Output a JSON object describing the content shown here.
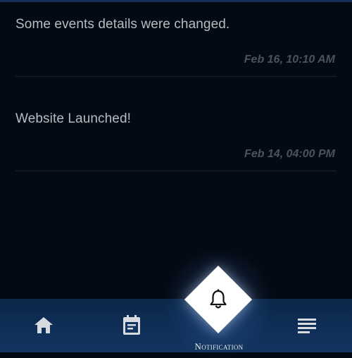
{
  "notifications": [
    {
      "message": "Some events details were changed.",
      "timestamp": "Feb 16, 10:10 AM"
    },
    {
      "message": "Website Launched!",
      "timestamp": "Feb 14, 04:00 PM"
    }
  ],
  "nav": {
    "items": [
      {
        "icon": "home-icon"
      },
      {
        "icon": "calendar-icon"
      },
      {
        "icon": "bell-icon",
        "label": "Notification",
        "active": true
      },
      {
        "icon": "menu-icon"
      }
    ]
  },
  "colors": {
    "background": "#040a14",
    "nav_bar": "#102f58",
    "message_text": "#b8bcc2",
    "timestamp_text": "#4a5260",
    "active_tab": "#ffffff"
  }
}
